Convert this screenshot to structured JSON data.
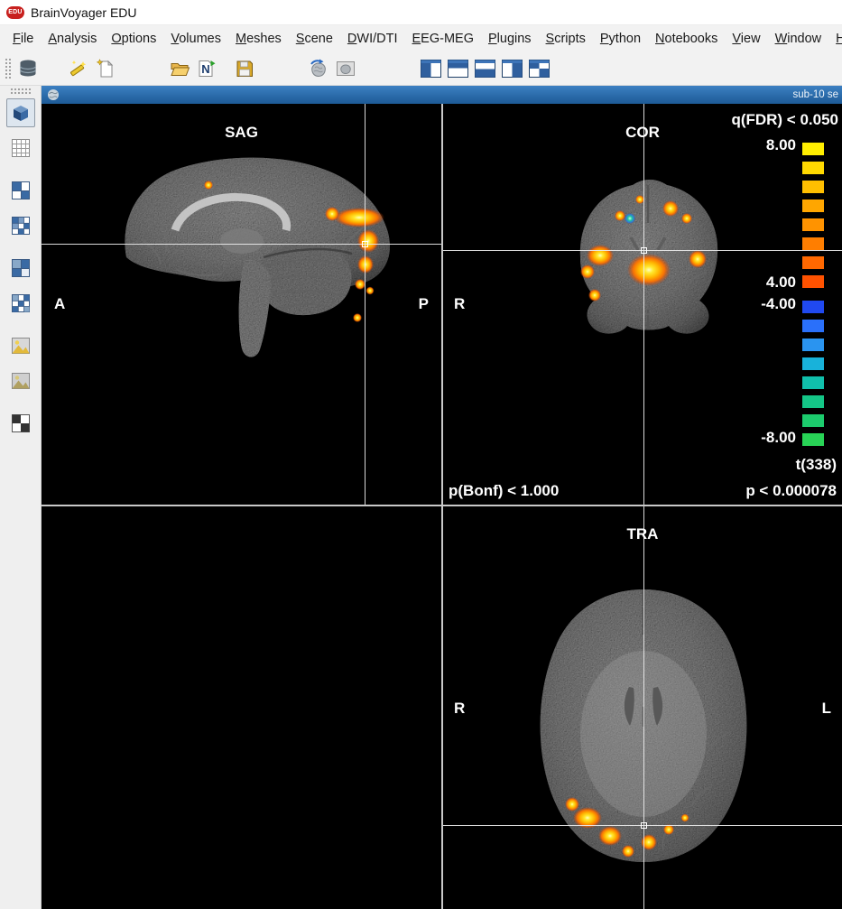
{
  "titlebar": {
    "title": "BrainVoyager EDU",
    "logo": "EDU"
  },
  "menubar": {
    "items": [
      {
        "label": "File"
      },
      {
        "label": "Analysis"
      },
      {
        "label": "Options"
      },
      {
        "label": "Volumes"
      },
      {
        "label": "Meshes"
      },
      {
        "label": "Scene"
      },
      {
        "label": "DWI/DTI"
      },
      {
        "label": "EEG-MEG"
      },
      {
        "label": "Plugins"
      },
      {
        "label": "Scripts"
      },
      {
        "label": "Python"
      },
      {
        "label": "Notebooks"
      },
      {
        "label": "View"
      },
      {
        "label": "Window"
      },
      {
        "label": "Help"
      }
    ]
  },
  "toolbar": {
    "icons": [
      "data-stack",
      "magic-wand",
      "new-document",
      "open-folder",
      "open-nifti",
      "save",
      "import-brain",
      "brain-frame",
      "layout-left",
      "layout-top",
      "layout-bottom",
      "layout-right",
      "layout-grid"
    ]
  },
  "sidebar": {
    "icons": [
      "slice-3d-view",
      "grid-table-view",
      "multislice-view-1",
      "multislice-view-2",
      "multislice-view-3",
      "multislice-view-4",
      "texture-map-1",
      "texture-map-2",
      "checkerboard-view"
    ]
  },
  "document": {
    "title": "sub-10  se",
    "views": {
      "sag": {
        "label": "SAG",
        "anterior": "A",
        "posterior": "P"
      },
      "cor": {
        "label": "COR",
        "left": "R"
      },
      "tra": {
        "label": "TRA",
        "left": "R",
        "right": "L"
      }
    },
    "stats": {
      "threshold_label": "q(FDR) < 0.050",
      "scale_max_pos": "8.00",
      "scale_min_pos": "4.00",
      "scale_min_neg": "-4.00",
      "scale_max_neg": "-8.00",
      "dof_label": "t(338)",
      "p_label": "p < 0.000078",
      "bonferroni_label": "p(Bonf) < 1.000"
    },
    "colorbar": {
      "positive": [
        "#ffee00",
        "#ffd900",
        "#ffbf00",
        "#ffa600",
        "#ff9300",
        "#ff7e00",
        "#ff6800",
        "#ff5200"
      ],
      "negative": [
        "#2049f0",
        "#2a70fa",
        "#2a94f0",
        "#18b2da",
        "#10c0ac",
        "#14c687",
        "#1ccb6d",
        "#28d356"
      ]
    }
  },
  "colors": {
    "accent_blue": "#1d5a96",
    "view_background": "#000000",
    "crosshair": "#ffffff"
  }
}
